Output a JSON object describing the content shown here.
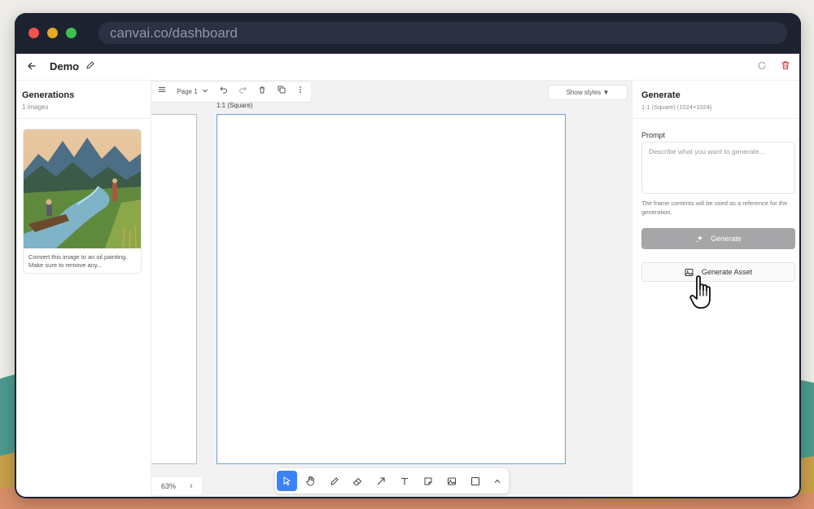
{
  "browser": {
    "url": "canvai.co/dashboard"
  },
  "header": {
    "title": "Demo",
    "icons": [
      "back-arrow-icon",
      "pencil-icon",
      "refresh-icon",
      "trash-icon"
    ],
    "danger_color": "#e5484d"
  },
  "generations": {
    "title": "Generations",
    "count_label": "1 images",
    "items": [
      {
        "caption": "Convert this image to an oil painting. Make sure to remove any...",
        "thumbnail_description": "oil-painting-landscape-boat-river-mountains"
      }
    ]
  },
  "canvas": {
    "toolbar": {
      "page_label": "Page 1",
      "icons": [
        "menu-icon",
        "chevron-down-icon",
        "undo-icon",
        "redo-icon",
        "trash-icon",
        "duplicate-icon",
        "more-vertical-icon"
      ]
    },
    "show_styles_label": "Show styles ▼",
    "frame_label": "1:1 (Square)",
    "zoom_label": "63%",
    "frame_border_color": "#6b9fd8",
    "draw_tools": [
      {
        "name": "select-tool",
        "icon": "cursor-icon",
        "active": true
      },
      {
        "name": "hand-tool",
        "icon": "hand-icon",
        "active": false
      },
      {
        "name": "pencil-tool",
        "icon": "pencil-icon",
        "active": false
      },
      {
        "name": "eraser-tool",
        "icon": "eraser-icon",
        "active": false
      },
      {
        "name": "arrow-tool",
        "icon": "arrow-icon",
        "active": false
      },
      {
        "name": "text-tool",
        "icon": "text-icon",
        "active": false
      },
      {
        "name": "note-tool",
        "icon": "sticky-note-icon",
        "active": false
      },
      {
        "name": "image-tool",
        "icon": "image-icon",
        "active": false
      },
      {
        "name": "frame-tool",
        "icon": "square-icon",
        "active": false
      },
      {
        "name": "more-tools",
        "icon": "chevron-up-icon",
        "active": false
      }
    ],
    "active_tool_color": "#3b82f6"
  },
  "generate_panel": {
    "title": "Generate",
    "subtitle": "1:1 (Square) (1024×1024)",
    "prompt_label": "Prompt",
    "prompt_placeholder": "Describe what you want to generate...",
    "prompt_value": "",
    "hint": "The frame contents will be used as a reference for the generation.",
    "generate_label": "Generate",
    "generate_asset_label": "Generate Asset"
  }
}
